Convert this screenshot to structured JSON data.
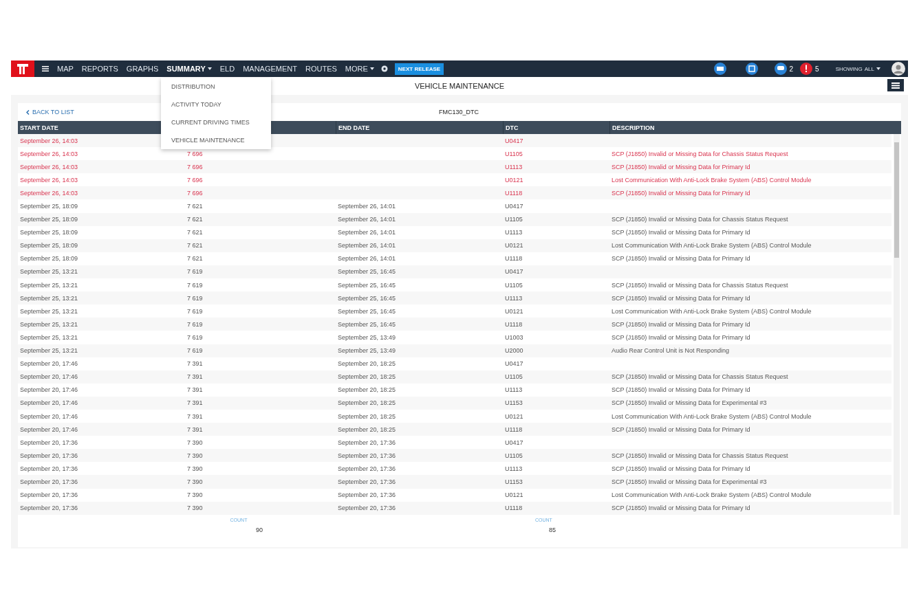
{
  "navbar": {
    "menu_items": [
      {
        "label": "MAP",
        "selected": false,
        "dropdown": false
      },
      {
        "label": "REPORTS",
        "selected": false,
        "dropdown": false
      },
      {
        "label": "GRAPHS",
        "selected": false,
        "dropdown": false
      },
      {
        "label": "SUMMARY",
        "selected": true,
        "dropdown": true
      },
      {
        "label": "ELD",
        "selected": false,
        "dropdown": false
      },
      {
        "label": "MANAGEMENT",
        "selected": false,
        "dropdown": false
      },
      {
        "label": "ROUTES",
        "selected": false,
        "dropdown": false
      },
      {
        "label": "MORE",
        "selected": false,
        "dropdown": true
      }
    ],
    "release_button": "NEXT RELEASE",
    "messages_count": "2",
    "alerts_count": "5",
    "showing_label": "SHOWING",
    "showing_value": "ALL"
  },
  "dropdown": [
    "DISTRIBUTION",
    "ACTIVITY TODAY",
    "CURRENT DRIVING TIMES",
    "VEHICLE MAINTENANCE"
  ],
  "page_title": "VEHICLE MAINTENANCE",
  "back_link": "BACK TO LIST",
  "vehicle": "FMC130_DTC",
  "table": {
    "columns": [
      "START DATE",
      "",
      "END DATE",
      "DTC",
      "DESCRIPTION"
    ],
    "rows": [
      {
        "start": "September 26, 14:03",
        "odometer": "",
        "end": "",
        "dtc": "U0417",
        "description": "",
        "active": true
      },
      {
        "start": "September 26, 14:03",
        "odometer": "7 696",
        "end": "",
        "dtc": "U1105",
        "description": "SCP (J1850) Invalid or Missing Data for Chassis Status Request",
        "active": true
      },
      {
        "start": "September 26, 14:03",
        "odometer": "7 696",
        "end": "",
        "dtc": "U1113",
        "description": "SCP (J1850) Invalid or Missing Data for Primary Id",
        "active": true
      },
      {
        "start": "September 26, 14:03",
        "odometer": "7 696",
        "end": "",
        "dtc": "U0121",
        "description": "Lost Communication With Anti-Lock Brake System (ABS) Control Module",
        "active": true
      },
      {
        "start": "September 26, 14:03",
        "odometer": "7 696",
        "end": "",
        "dtc": "U1118",
        "description": "SCP (J1850) Invalid or Missing Data for Primary Id",
        "active": true
      },
      {
        "start": "September 25, 18:09",
        "odometer": "7 621",
        "end": "September 26, 14:01",
        "dtc": "U0417",
        "description": "",
        "active": false
      },
      {
        "start": "September 25, 18:09",
        "odometer": "7 621",
        "end": "September 26, 14:01",
        "dtc": "U1105",
        "description": "SCP (J1850) Invalid or Missing Data for Chassis Status Request",
        "active": false
      },
      {
        "start": "September 25, 18:09",
        "odometer": "7 621",
        "end": "September 26, 14:01",
        "dtc": "U1113",
        "description": "SCP (J1850) Invalid or Missing Data for Primary Id",
        "active": false
      },
      {
        "start": "September 25, 18:09",
        "odometer": "7 621",
        "end": "September 26, 14:01",
        "dtc": "U0121",
        "description": "Lost Communication With Anti-Lock Brake System (ABS) Control Module",
        "active": false
      },
      {
        "start": "September 25, 18:09",
        "odometer": "7 621",
        "end": "September 26, 14:01",
        "dtc": "U1118",
        "description": "SCP (J1850) Invalid or Missing Data for Primary Id",
        "active": false
      },
      {
        "start": "September 25, 13:21",
        "odometer": "7 619",
        "end": "September 25, 16:45",
        "dtc": "U0417",
        "description": "",
        "active": false
      },
      {
        "start": "September 25, 13:21",
        "odometer": "7 619",
        "end": "September 25, 16:45",
        "dtc": "U1105",
        "description": "SCP (J1850) Invalid or Missing Data for Chassis Status Request",
        "active": false
      },
      {
        "start": "September 25, 13:21",
        "odometer": "7 619",
        "end": "September 25, 16:45",
        "dtc": "U1113",
        "description": "SCP (J1850) Invalid or Missing Data for Primary Id",
        "active": false
      },
      {
        "start": "September 25, 13:21",
        "odometer": "7 619",
        "end": "September 25, 16:45",
        "dtc": "U0121",
        "description": "Lost Communication With Anti-Lock Brake System (ABS) Control Module",
        "active": false
      },
      {
        "start": "September 25, 13:21",
        "odometer": "7 619",
        "end": "September 25, 16:45",
        "dtc": "U1118",
        "description": "SCP (J1850) Invalid or Missing Data for Primary Id",
        "active": false
      },
      {
        "start": "September 25, 13:21",
        "odometer": "7 619",
        "end": "September 25, 13:49",
        "dtc": "U1003",
        "description": "SCP (J1850) Invalid or Missing Data for Primary Id",
        "active": false
      },
      {
        "start": "September 25, 13:21",
        "odometer": "7 619",
        "end": "September 25, 13:49",
        "dtc": "U2000",
        "description": "Audio Rear Control Unit is Not Responding",
        "active": false
      },
      {
        "start": "September 20, 17:46",
        "odometer": "7 391",
        "end": "September 20, 18:25",
        "dtc": "U0417",
        "description": "",
        "active": false
      },
      {
        "start": "September 20, 17:46",
        "odometer": "7 391",
        "end": "September 20, 18:25",
        "dtc": "U1105",
        "description": "SCP (J1850) Invalid or Missing Data for Chassis Status Request",
        "active": false
      },
      {
        "start": "September 20, 17:46",
        "odometer": "7 391",
        "end": "September 20, 18:25",
        "dtc": "U1113",
        "description": "SCP (J1850) Invalid or Missing Data for Primary Id",
        "active": false
      },
      {
        "start": "September 20, 17:46",
        "odometer": "7 391",
        "end": "September 20, 18:25",
        "dtc": "U1153",
        "description": "SCP (J1850) Invalid or Missing Data for Experimental #3",
        "active": false
      },
      {
        "start": "September 20, 17:46",
        "odometer": "7 391",
        "end": "September 20, 18:25",
        "dtc": "U0121",
        "description": "Lost Communication With Anti-Lock Brake System (ABS) Control Module",
        "active": false
      },
      {
        "start": "September 20, 17:46",
        "odometer": "7 391",
        "end": "September 20, 18:25",
        "dtc": "U1118",
        "description": "SCP (J1850) Invalid or Missing Data for Primary Id",
        "active": false
      },
      {
        "start": "September 20, 17:36",
        "odometer": "7 390",
        "end": "September 20, 17:36",
        "dtc": "U0417",
        "description": "",
        "active": false
      },
      {
        "start": "September 20, 17:36",
        "odometer": "7 390",
        "end": "September 20, 17:36",
        "dtc": "U1105",
        "description": "SCP (J1850) Invalid or Missing Data for Chassis Status Request",
        "active": false
      },
      {
        "start": "September 20, 17:36",
        "odometer": "7 390",
        "end": "September 20, 17:36",
        "dtc": "U1113",
        "description": "SCP (J1850) Invalid or Missing Data for Primary Id",
        "active": false
      },
      {
        "start": "September 20, 17:36",
        "odometer": "7 390",
        "end": "September 20, 17:36",
        "dtc": "U1153",
        "description": "SCP (J1850) Invalid or Missing Data for Experimental #3",
        "active": false
      },
      {
        "start": "September 20, 17:36",
        "odometer": "7 390",
        "end": "September 20, 17:36",
        "dtc": "U0121",
        "description": "Lost Communication With Anti-Lock Brake System (ABS) Control Module",
        "active": false
      },
      {
        "start": "September 20, 17:36",
        "odometer": "7 390",
        "end": "September 20, 17:36",
        "dtc": "U1118",
        "description": "SCP (J1850) Invalid or Missing Data for Primary Id",
        "active": false
      }
    ],
    "footer": [
      {
        "label": "COUNT",
        "value": "90"
      },
      {
        "label": "COUNT",
        "value": "85"
      }
    ]
  }
}
